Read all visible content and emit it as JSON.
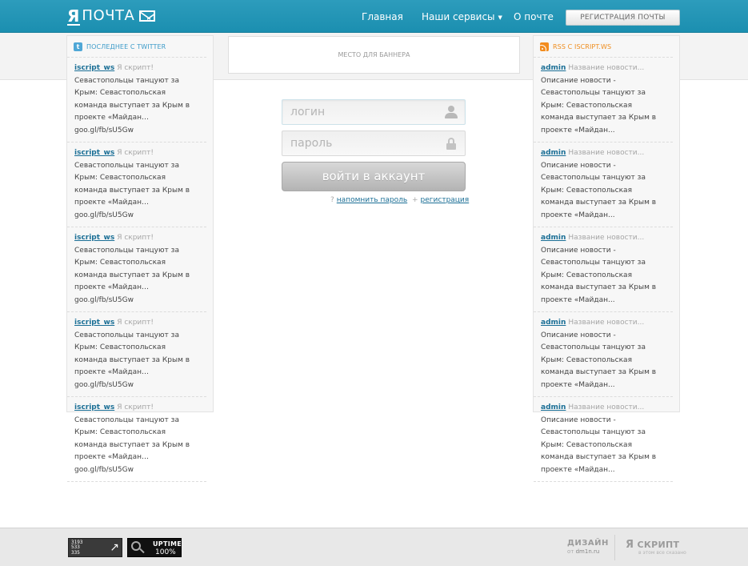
{
  "header": {
    "logo_ya": "Я",
    "logo_text": "ПОЧТА",
    "nav": [
      {
        "label": "Главная"
      },
      {
        "label": "Наши сервисы"
      },
      {
        "label": "О почте"
      }
    ],
    "register_button": "регистрация почты"
  },
  "banner": {
    "label": "место для баннера"
  },
  "twitter": {
    "title": "последнее с twitter",
    "items": [
      {
        "author": "iscript_ws",
        "meta": "Я скрипт!",
        "text": "Севастопольцы танцуют за Крым: Севастопольская команда выступает за Крым в проекте «Майдан… goo.gl/fb/sU5Gw"
      },
      {
        "author": "iscript_ws",
        "meta": "Я скрипт!",
        "text": "Севастопольцы танцуют за Крым: Севастопольская команда выступает за Крым в проекте «Майдан… goo.gl/fb/sU5Gw"
      },
      {
        "author": "iscript_ws",
        "meta": "Я скрипт!",
        "text": "Севастопольцы танцуют за Крым: Севастопольская команда выступает за Крым в проекте «Майдан… goo.gl/fb/sU5Gw"
      },
      {
        "author": "iscript_ws",
        "meta": "Я скрипт!",
        "text": "Севастопольцы танцуют за Крым: Севастопольская команда выступает за Крым в проекте «Майдан… goo.gl/fb/sU5Gw"
      },
      {
        "author": "iscript_ws",
        "meta": "Я скрипт!",
        "text": "Севастопольцы танцуют за Крым: Севастопольская команда выступает за Крым в проекте «Майдан… goo.gl/fb/sU5Gw"
      }
    ]
  },
  "rss": {
    "title": "rss с iscript.ws",
    "items": [
      {
        "author": "admin",
        "meta": "Название новости...",
        "text": "Описание новости - Севастопольцы танцуют за Крым: Севастопольская команда выступает за Крым в проекте «Майдан..."
      },
      {
        "author": "admin",
        "meta": "Название новости...",
        "text": "Описание новости - Севастопольцы танцуют за Крым: Севастопольская команда выступает за Крым в проекте «Майдан..."
      },
      {
        "author": "admin",
        "meta": "Название новости...",
        "text": "Описание новости - Севастопольцы танцуют за Крым: Севастопольская команда выступает за Крым в проекте «Майдан..."
      },
      {
        "author": "admin",
        "meta": "Название новости...",
        "text": "Описание новости - Севастопольцы танцуют за Крым: Севастопольская команда выступает за Крым в проекте «Майдан..."
      },
      {
        "author": "admin",
        "meta": "Название новости...",
        "text": "Описание новости - Севастопольцы танцуют за Крым: Севастопольская команда выступает за Крым в проекте «Майдан..."
      }
    ]
  },
  "login": {
    "login_placeholder": "логин",
    "password_placeholder": "пароль",
    "submit": "войти в аккаунт",
    "remind_prefix": "?",
    "remind": "напомнить пароль",
    "register_prefix": "+",
    "register": "регистрация"
  },
  "footer": {
    "counter1_lines": [
      "3193",
      "533",
      "335"
    ],
    "counter2_label": "UPTIME",
    "counter2_value": "100%",
    "design_title": "ДИЗАЙН",
    "design_prefix": "от",
    "design_site": "dm1n.ru",
    "script_ya": "Я",
    "script_title": "СКРИПТ",
    "script_sub": "в этом все сказано"
  },
  "colors": {
    "header": "#1e93b4",
    "twitter_title": "#3c9bc9",
    "rss_title": "#ef8c1c",
    "link": "#1b6f96"
  }
}
